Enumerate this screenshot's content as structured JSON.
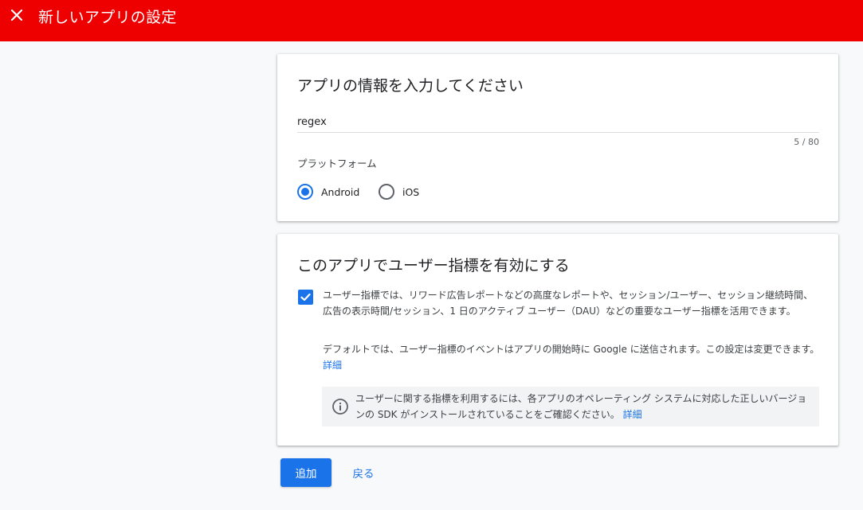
{
  "header": {
    "title": "新しいアプリの設定",
    "color": "#ee0000"
  },
  "app_info": {
    "title": "アプリの情報を入力してください",
    "name_value": "regex",
    "char_count": "5 / 80",
    "platform_label": "プラットフォーム",
    "platforms": [
      {
        "label": "Android",
        "selected": true
      },
      {
        "label": "iOS",
        "selected": false
      }
    ]
  },
  "user_metrics": {
    "title": "このアプリでユーザー指標を有効にする",
    "checked": true,
    "description": "ユーザー指標では、リワード広告レポートなどの高度なレポートや、セッション/ユーザー、セッション継続時間、広告の表示時間/セッション、1 日のアクティブ ユーザー（DAU）などの重要なユーザー指標を活用できます。",
    "default_text": "デフォルトでは、ユーザー指標のイベントはアプリの開始時に Google に送信されます。この設定は変更できます。",
    "details_link": "詳細",
    "notice_text": "ユーザーに関する指標を利用するには、各アプリのオペレーティング システムに対応した正しいバージョンの SDK がインストールされていることをご確認ください。",
    "notice_link": "詳細"
  },
  "actions": {
    "add_label": "追加",
    "back_label": "戻る"
  },
  "colors": {
    "accent": "#1a73e8"
  }
}
